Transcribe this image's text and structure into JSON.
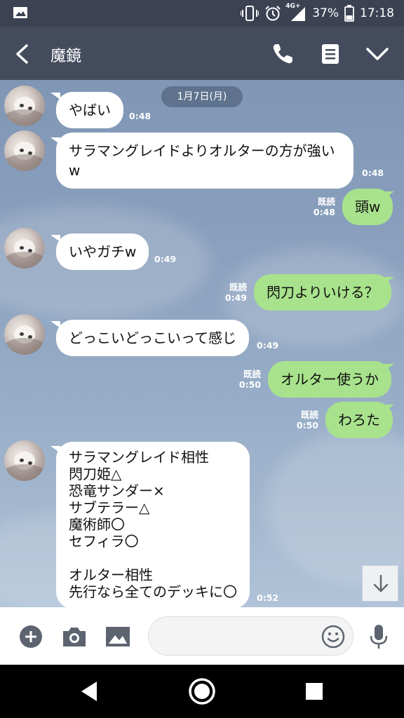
{
  "status_bar": {
    "network": "4G+",
    "battery": "37%",
    "time": "17:18",
    "icons": [
      "image-icon",
      "vibrate-icon",
      "alarm-icon",
      "signal-icon",
      "battery-icon"
    ]
  },
  "header": {
    "title": "魔鏡",
    "icons": [
      "back-arrow-icon",
      "phone-icon",
      "menu-icon",
      "chevron-down-icon"
    ]
  },
  "chat": {
    "date": "1月7日(月)",
    "messages": [
      {
        "side": "in",
        "text": "やばい",
        "time": "0:48"
      },
      {
        "side": "in",
        "text": "サラマングレイドよりオルターの方が強い\nw",
        "time": "0:48"
      },
      {
        "side": "out",
        "text": "頭w",
        "read": "既読",
        "time": "0:48"
      },
      {
        "side": "in",
        "text": "いやガチw",
        "time": "0:49"
      },
      {
        "side": "out",
        "text": "閃刀よりいける？",
        "read": "既読",
        "time": "0:49"
      },
      {
        "side": "in",
        "text": "どっこいどっこいって感じ",
        "time": "0:49"
      },
      {
        "side": "out",
        "text": "オルター使うか",
        "read": "既読",
        "time": "0:50"
      },
      {
        "side": "out",
        "text": "わろた",
        "read": "既読",
        "time": "0:50"
      },
      {
        "side": "in",
        "text": "サラマングレイド相性\n閃刀姫△\n恐竜サンダー×\nサブテラー△\n魔術師〇\nセフィラ〇\n\nオルター相性\n先行なら全てのデッキに〇",
        "time": "0:52"
      }
    ]
  },
  "input_bar": {
    "placeholder": "",
    "icons": [
      "plus-icon",
      "camera-icon",
      "image-icon",
      "emoji-icon",
      "microphone-icon"
    ]
  },
  "nav_bar": {
    "icons": [
      "back-icon",
      "home-icon",
      "recents-icon"
    ]
  },
  "colors": {
    "header_bg": "#444b5d",
    "status_bg": "#3c4252",
    "bubble_out": "#a8e28c",
    "bubble_in": "#ffffff"
  }
}
